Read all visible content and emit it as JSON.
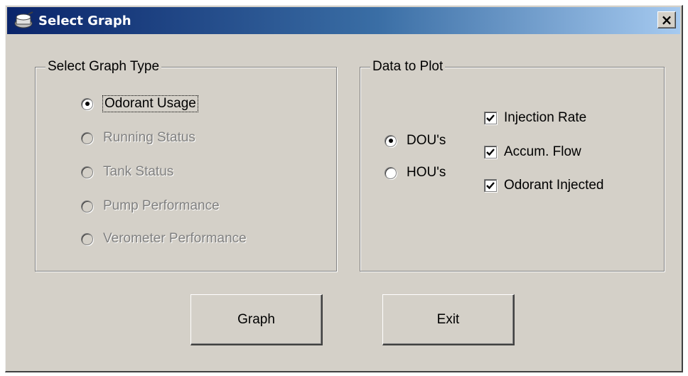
{
  "window": {
    "title": "Select Graph",
    "icon": "graph-app-icon",
    "close_label": "×"
  },
  "graph_type": {
    "label": "Select Graph Type",
    "options": [
      {
        "label": "Odorant Usage",
        "selected": true,
        "enabled": true
      },
      {
        "label": "Running Status",
        "selected": false,
        "enabled": false
      },
      {
        "label": "Tank Status",
        "selected": false,
        "enabled": false
      },
      {
        "label": "Pump Performance",
        "selected": false,
        "enabled": false
      },
      {
        "label": "Verometer Performance",
        "selected": false,
        "enabled": false
      }
    ]
  },
  "data_to_plot": {
    "label": "Data to Plot",
    "units": [
      {
        "label": "DOU's",
        "selected": true
      },
      {
        "label": "HOU's",
        "selected": false
      }
    ],
    "series": [
      {
        "label": "Injection Rate",
        "checked": true
      },
      {
        "label": "Accum. Flow",
        "checked": true
      },
      {
        "label": "Odorant Injected",
        "checked": true
      }
    ]
  },
  "buttons": {
    "graph": "Graph",
    "exit": "Exit"
  },
  "colors": {
    "dialog_bg": "#d4d0c8",
    "title_start": "#0a246a",
    "title_end": "#a6caf0"
  }
}
